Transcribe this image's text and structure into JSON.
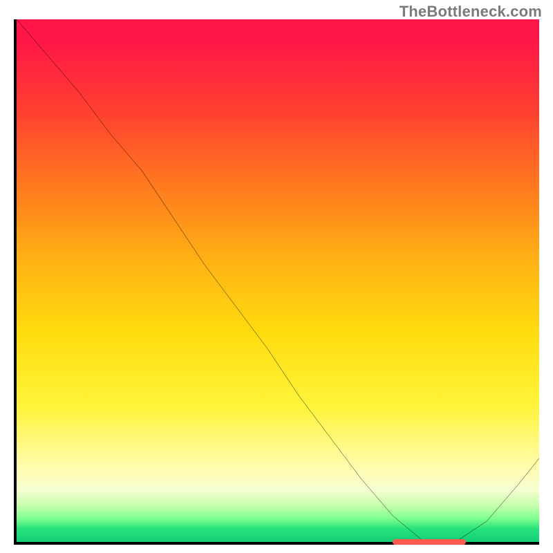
{
  "attribution": "TheBottleneck.com",
  "colors": {
    "axis": "#000000",
    "curve": "#000000",
    "marker": "#ff5a4d",
    "gradient_top": "#ff1648",
    "gradient_mid": "#fff43a",
    "gradient_bottom": "#14cf78"
  },
  "chart_data": {
    "type": "line",
    "title": "",
    "xlabel": "",
    "ylabel": "",
    "xlim": [
      0,
      100
    ],
    "ylim": [
      0,
      100
    ],
    "grid": false,
    "legend": false,
    "series": [
      {
        "name": "curve",
        "x": [
          0,
          6,
          12,
          18,
          24,
          30,
          36,
          42,
          48,
          54,
          60,
          66,
          72,
          78,
          84,
          90,
          96,
          100
        ],
        "y": [
          100,
          93,
          86,
          78,
          71,
          62,
          53,
          45,
          37,
          28,
          20,
          12,
          5,
          0,
          0,
          4,
          11,
          16
        ]
      }
    ],
    "annotations": [
      {
        "name": "bottleneck-marker",
        "x_start": 72,
        "x_end": 86,
        "y": 0
      }
    ]
  }
}
